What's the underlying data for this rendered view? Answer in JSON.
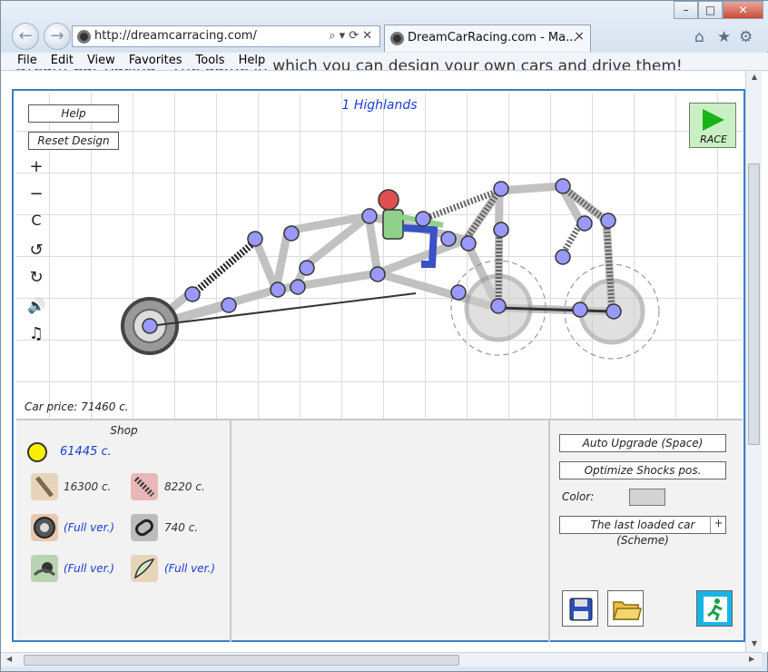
{
  "browser": {
    "url": "http://dreamcarracing.com/",
    "tab_title": "DreamCarRacing.com - Ma...",
    "tab_close": "×",
    "win_minimize": "–",
    "win_restore": "□",
    "win_close": "✕"
  },
  "menu": {
    "items": [
      "File",
      "Edit",
      "View",
      "Favorites",
      "Tools",
      "Help"
    ],
    "page_headline": "Dream Car Racing - The game in which you can design your own cars and drive them!"
  },
  "game": {
    "help_label": "Help",
    "reset_label": "Reset Design",
    "track_title": "1 Highlands",
    "race_label": "RACE",
    "car_price": "Car price: 71460 c.",
    "tools": [
      "zoom-in",
      "zoom-out",
      "reset-zoom",
      "undo",
      "redo",
      "sound",
      "music"
    ],
    "colors": {
      "accent": "#3a7ec9",
      "joint": "#9999ff",
      "race_button": "#c9f0c2",
      "money_text": "#1a3bd6",
      "coin": "#f8f000"
    }
  },
  "shop": {
    "title": "Shop",
    "money": "61445 c.",
    "items": [
      {
        "icon": "beam-icon",
        "value": "16300 c."
      },
      {
        "icon": "shock-absorber-icon",
        "value": "8220 c."
      },
      {
        "icon": "wheel-icon",
        "value": "(Full ver.)"
      },
      {
        "icon": "chain-icon",
        "value": "740 c."
      },
      {
        "icon": "engine-icon",
        "value": "(Full ver.)"
      },
      {
        "icon": "wing-icon",
        "value": "(Full ver.)"
      }
    ]
  },
  "panel": {
    "auto_upgrade": "Auto Upgrade (Space)",
    "optimize": "Optimize Shocks pos.",
    "color_label": "Color:",
    "color_value": "#d3d3d3",
    "loaded_car": "The last loaded car",
    "plus_label": "+",
    "scheme": "(Scheme)"
  }
}
